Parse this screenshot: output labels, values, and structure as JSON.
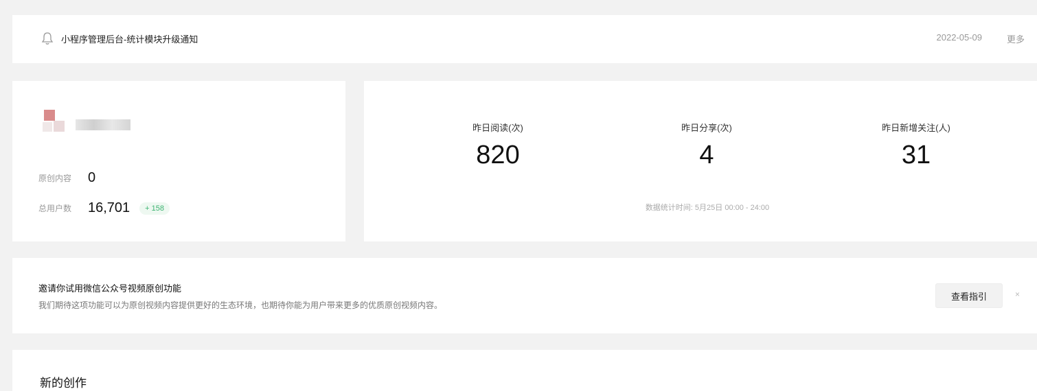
{
  "notice": {
    "icon": "bell-icon",
    "title": "小程序管理后台-统计模块升级通知",
    "date": "2022-05-09",
    "more": "更多"
  },
  "account": {
    "original_label": "原创内容",
    "original_value": "0",
    "users_label": "总用户数",
    "users_value": "16,701",
    "users_growth": "+ 158"
  },
  "yesterday": {
    "metrics": [
      {
        "label": "昨日阅读(次)",
        "value": "820"
      },
      {
        "label": "昨日分享(次)",
        "value": "4"
      },
      {
        "label": "昨日新增关注(人)",
        "value": "31"
      }
    ],
    "stat_time": "数据统计时间: 5月25日 00:00 - 24:00"
  },
  "invite": {
    "title": "邀请你试用微信公众号视频原创功能",
    "description": "我们期待这项功能可以为原创视频内容提供更好的生态环境，也期待你能为用户带来更多的优质原创视频内容。",
    "guide_button": "查看指引",
    "close": "×"
  },
  "create": {
    "title": "新的创作"
  },
  "colors": {
    "background": "#f2f2f2",
    "card": "#ffffff",
    "growth_green": "#3cb371"
  }
}
